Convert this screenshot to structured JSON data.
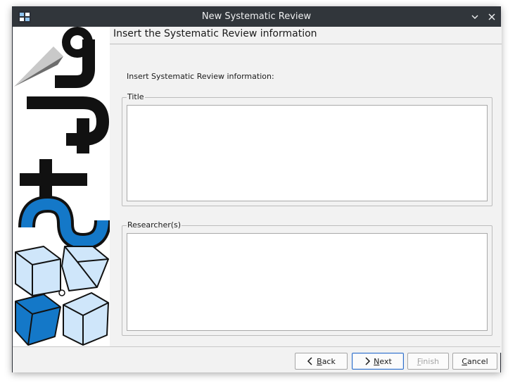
{
  "window": {
    "title": "New Systematic Review"
  },
  "page": {
    "header_title": "Insert the Systematic Review information",
    "instructions": "Insert Systematic Review information:"
  },
  "fields": {
    "title_label": "Title",
    "title_value": "",
    "researchers_label": "Researcher(s)",
    "researchers_value": ""
  },
  "footer": {
    "back": {
      "first": "B",
      "rest": "ack"
    },
    "next": {
      "first": "N",
      "rest": "ext"
    },
    "finish": {
      "first": "F",
      "rest": "inish"
    },
    "cancel": {
      "first": "C",
      "rest": "ancel"
    }
  },
  "colors": {
    "titlebar": "#31363b",
    "logo_blue": "#1478c8",
    "cube_light": "#cfe6fa",
    "focus_border": "#2e6ec9"
  },
  "icons": {
    "minimize": "chevron-down-icon",
    "close": "close-icon",
    "back": "chevron-left-icon",
    "next": "chevron-right-icon"
  }
}
